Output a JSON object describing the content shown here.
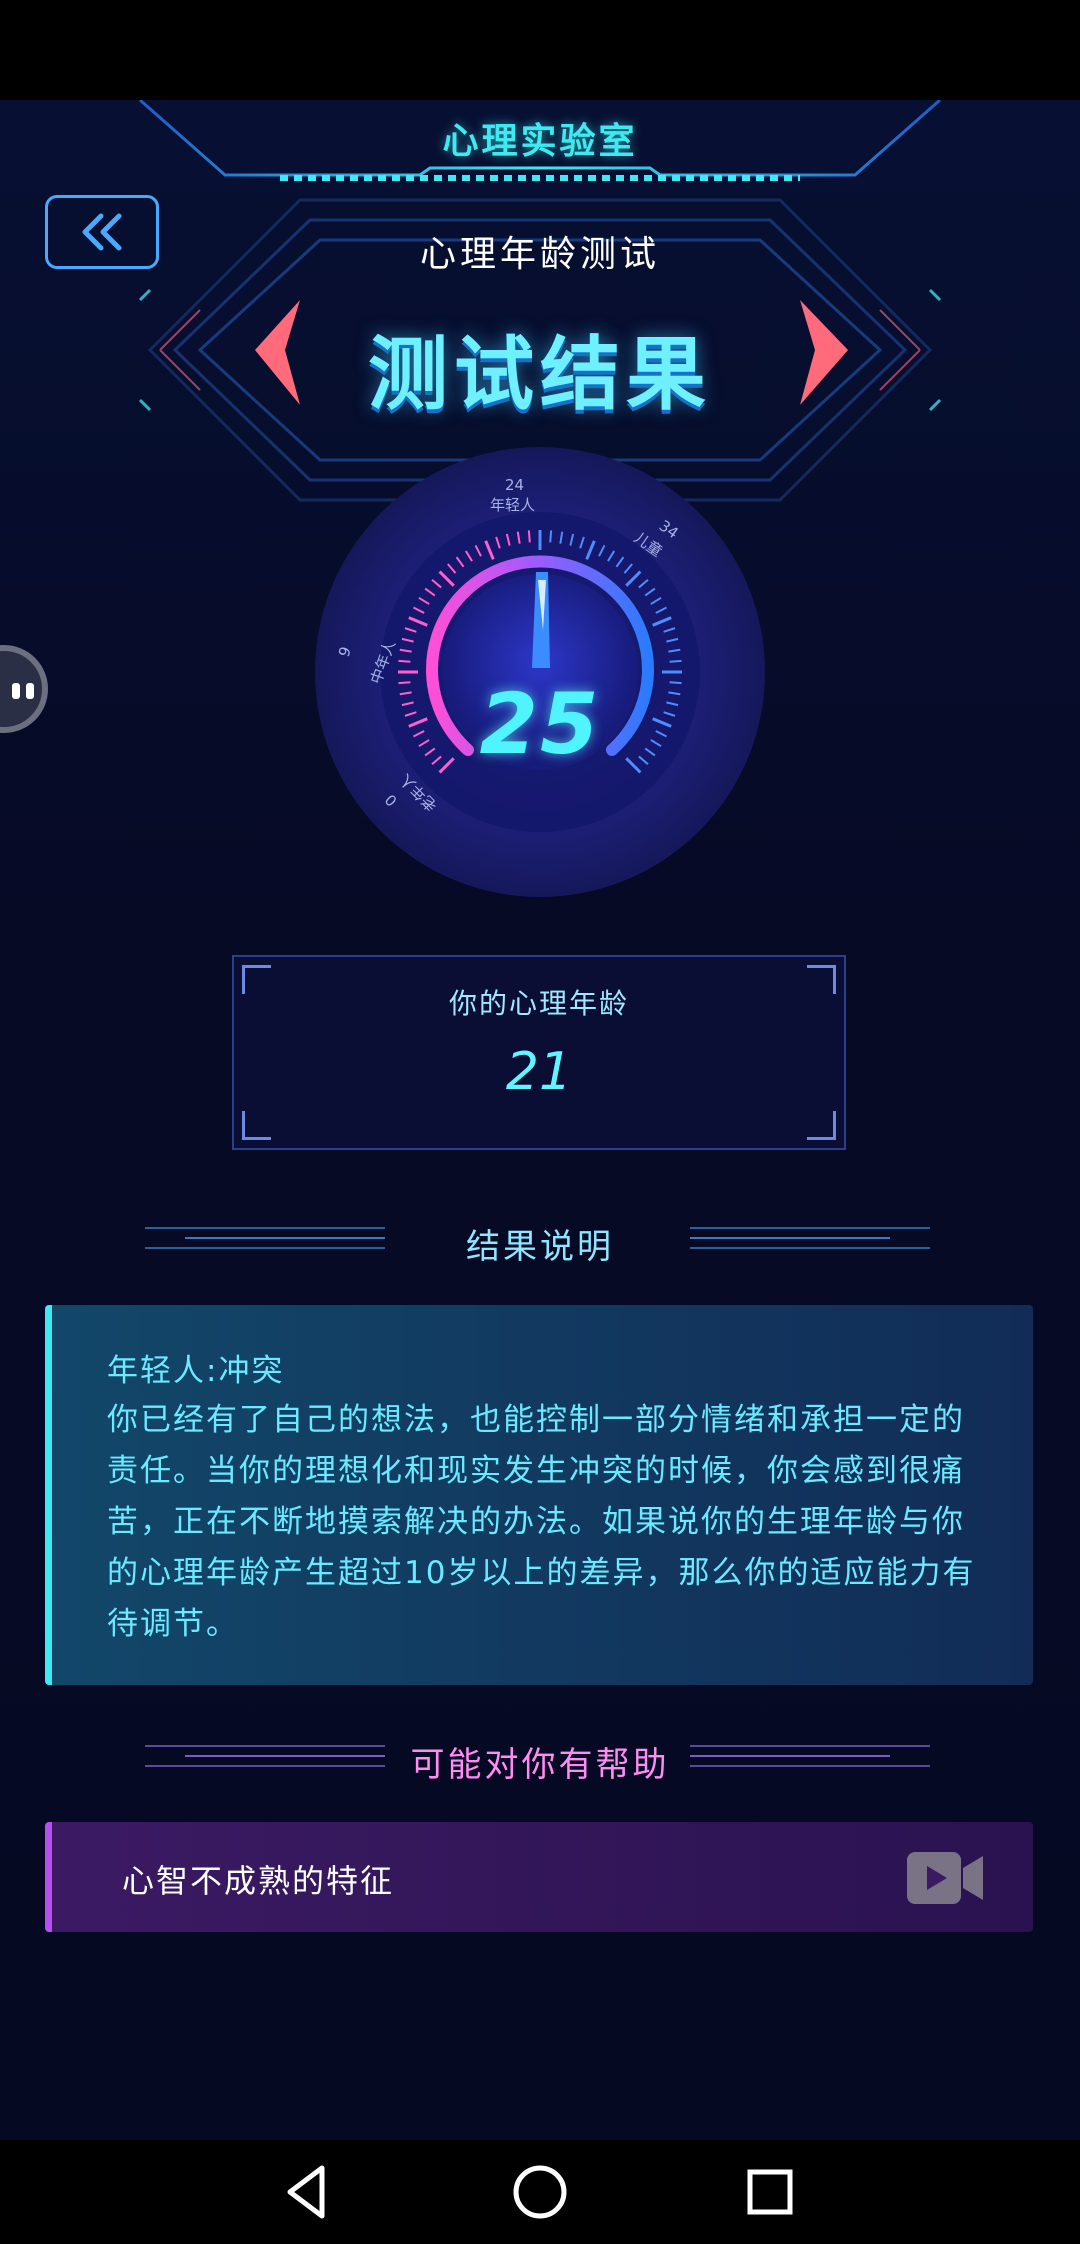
{
  "header": {
    "title": "心理实验室"
  },
  "test": {
    "subtitle": "心理年龄测试",
    "result_title": "测试结果"
  },
  "gauge": {
    "value": "25",
    "labels": [
      {
        "text": "24"
      },
      {
        "text": "年轻人"
      },
      {
        "text": "34"
      },
      {
        "text": "儿童"
      },
      {
        "text": "9"
      },
      {
        "text": "中年人"
      },
      {
        "text": "0"
      },
      {
        "text": "老年人"
      }
    ],
    "colors": {
      "start": "#ff4fd8",
      "end": "#2b7bff"
    }
  },
  "age_box": {
    "label": "你的心理年龄",
    "value": "21"
  },
  "result_section": {
    "title": "结果说明",
    "heading": "年轻人:冲突",
    "body": "你已经有了自己的想法，也能控制一部分情绪和承担一定的责任。当你的理想化和现实发生冲突的时候，你会感到很痛苦，正在不断地摸索解决的办法。如果说你的生理年龄与你的心理年龄产生超过10岁以上的差异，那么你的适应能力有待调节。"
  },
  "help_section": {
    "title": "可能对你有帮助",
    "items": [
      {
        "label": "心智不成熟的特征",
        "icon": "video-camera-icon"
      }
    ]
  },
  "theme": {
    "accent": "#3ee9f0",
    "pink": "#ff8cf0",
    "purple": "#b54ff0"
  }
}
